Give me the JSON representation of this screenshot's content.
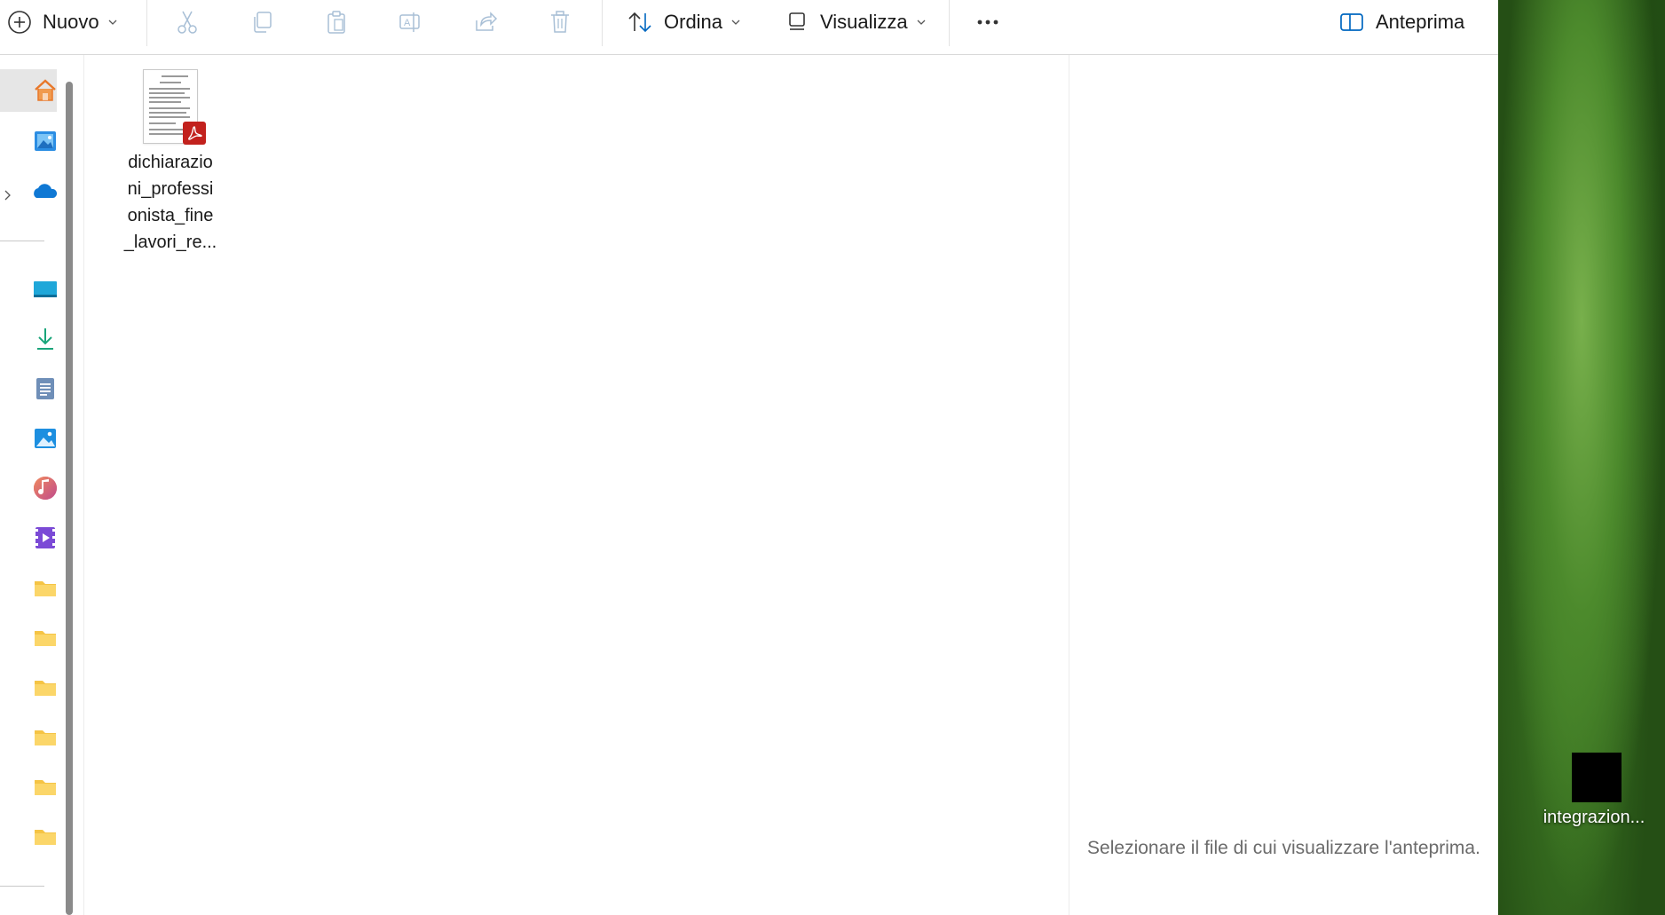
{
  "toolbar": {
    "new_label": "Nuovo",
    "sort_label": "Ordina",
    "view_label": "Visualizza",
    "preview_label": "Anteprima"
  },
  "file_list": {
    "items": [
      {
        "name": "dichiarazioni_professionista_fine_lavori_re...",
        "type": "pdf-icon"
      }
    ]
  },
  "preview_pane": {
    "message": "Selezionare il file di cui visualizzare l'anteprima."
  },
  "desktop": {
    "icons": [
      {
        "name": "integrazion..."
      }
    ]
  },
  "colors": {
    "accent": "#0067c0",
    "pdf_red": "#c2211d",
    "folder_yellow": "#f5c445"
  }
}
